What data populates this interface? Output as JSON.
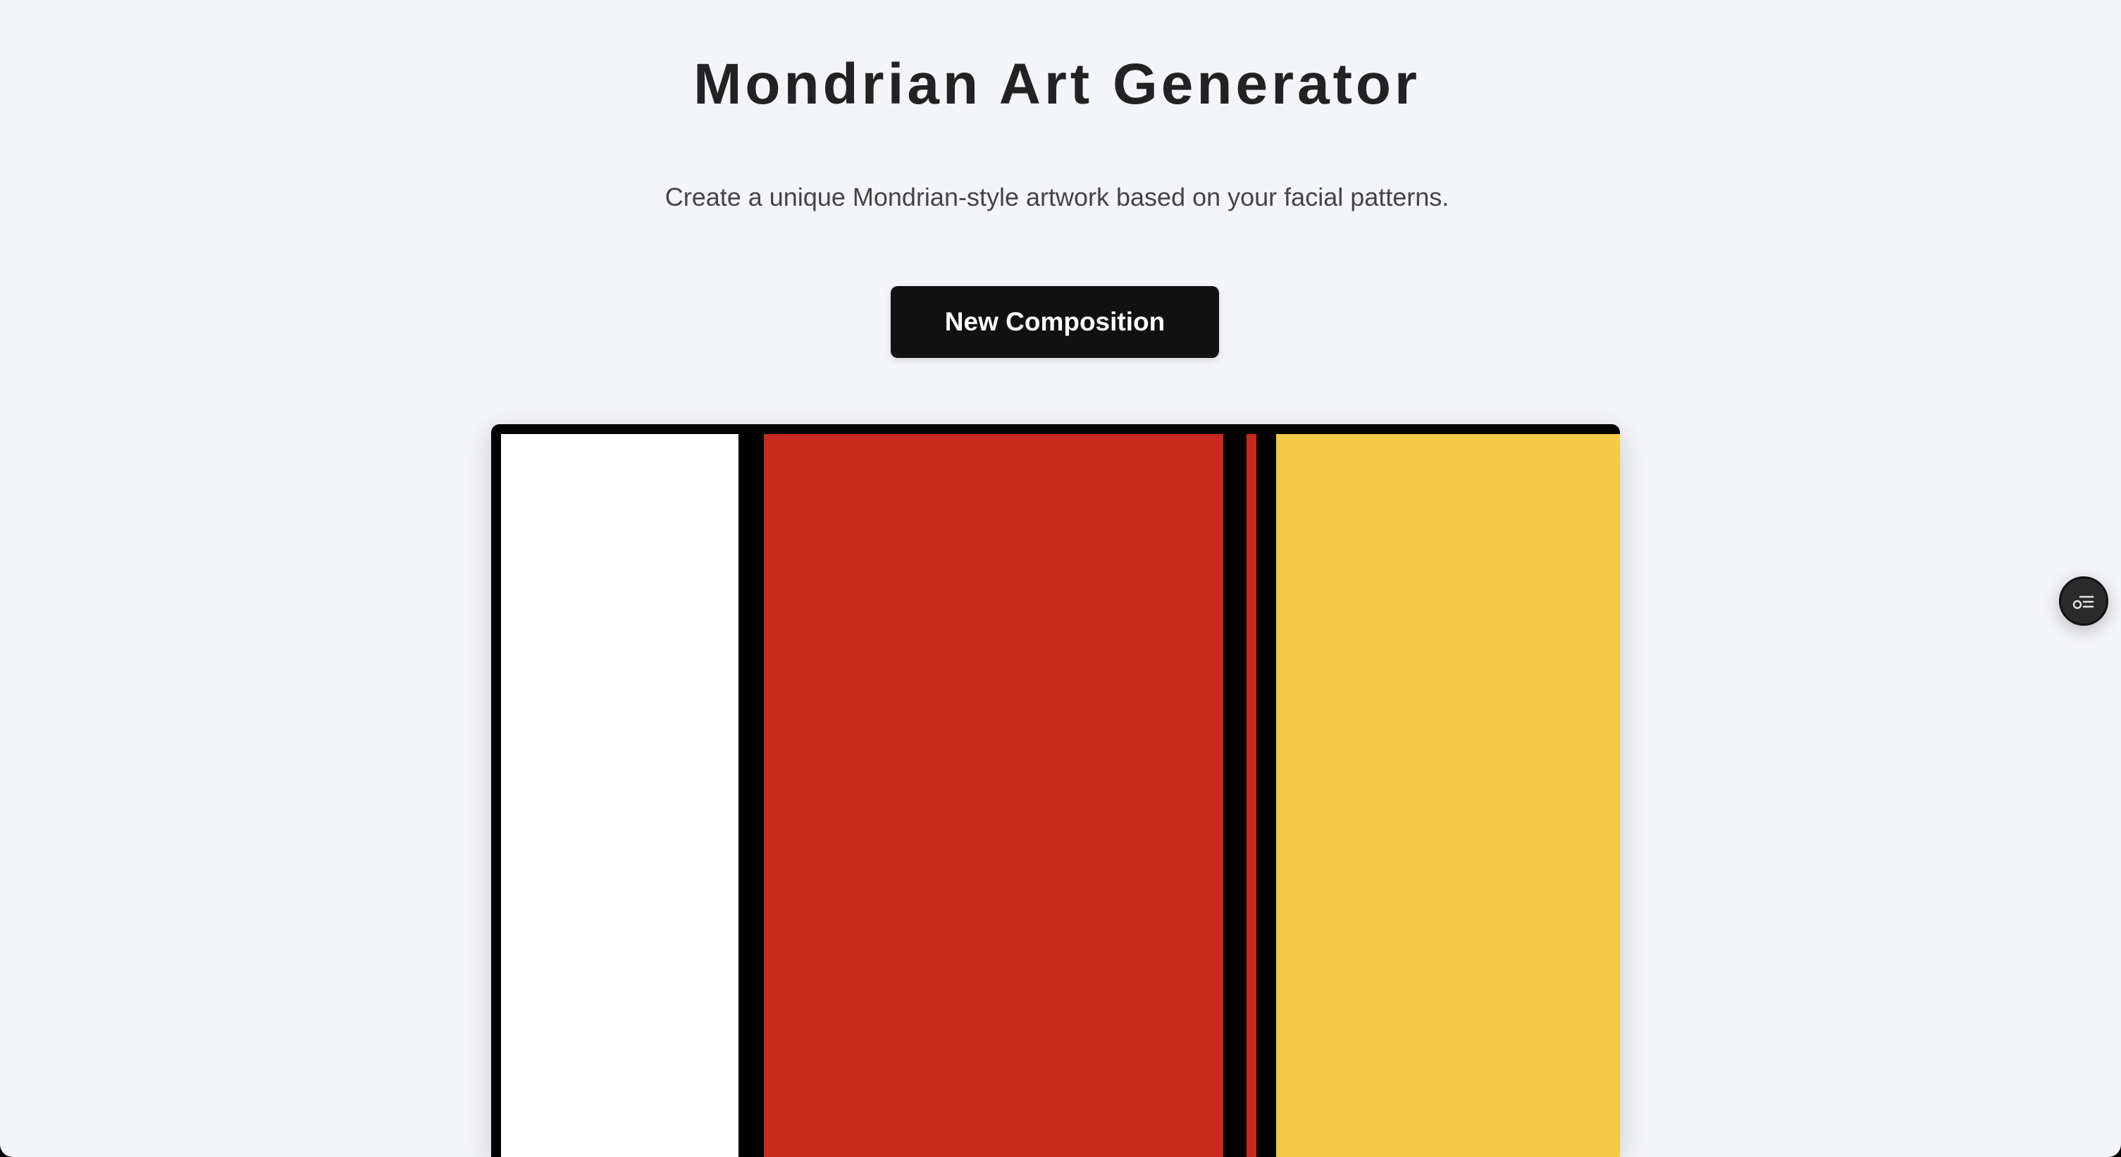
{
  "header": {
    "title": "Mondrian Art Generator",
    "subtitle": "Create a unique Mondrian-style artwork based on your facial patterns."
  },
  "actions": {
    "new_composition_label": "New Composition"
  },
  "artwork": {
    "line_color": "#000000",
    "block_colors": [
      "#ffffff",
      "#c92a1e",
      "#c92a1e",
      "#f4cb47"
    ]
  },
  "colors": {
    "page_background": "#f4f5f9",
    "button_background": "#111111",
    "button_text": "#ffffff",
    "title_text": "#222222",
    "subtitle_text": "#444444"
  },
  "icons": {
    "floating_button": "settings-list-icon"
  }
}
